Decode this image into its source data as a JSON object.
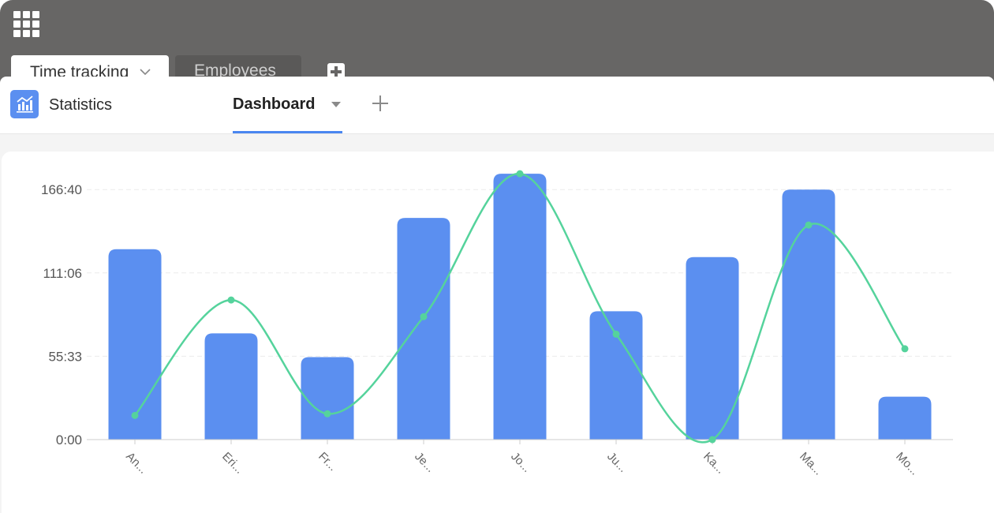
{
  "topbar": {
    "apps_icon": "apps-grid-icon",
    "tabs": [
      {
        "label": "Time tracking",
        "active": true,
        "icon": "chevron-down-icon"
      },
      {
        "label": "Employees",
        "active": false
      }
    ],
    "add_icon": "plus-square-icon"
  },
  "header": {
    "app_icon": "chart-icon",
    "app_title": "Statistics",
    "view_tab": {
      "label": "Dashboard",
      "icon": "caret-down-icon"
    },
    "add_view_icon": "plus-icon"
  },
  "colors": {
    "bar": "#5b8ff0",
    "line": "#55d39c",
    "active_tab": "#4a86f0"
  },
  "chart_data": {
    "type": "bar",
    "categories": [
      "An...",
      "Eri...",
      "Fr...",
      "Je...",
      "Jo...",
      "Ju...",
      "Ka...",
      "Ma...",
      "Mo..."
    ],
    "y_ticks": [
      "0:00",
      "55:33",
      "111:06",
      "166:40"
    ],
    "ylim": [
      0,
      600000
    ],
    "series": [
      {
        "type": "bar",
        "values": [
          457000,
          255000,
          198000,
          532000,
          638000,
          308000,
          438000,
          600000,
          103000
        ]
      },
      {
        "type": "line",
        "values": [
          58000,
          335000,
          62000,
          295000,
          638000,
          253000,
          0,
          515000,
          218000
        ]
      }
    ],
    "grid": true,
    "legend": "none"
  }
}
